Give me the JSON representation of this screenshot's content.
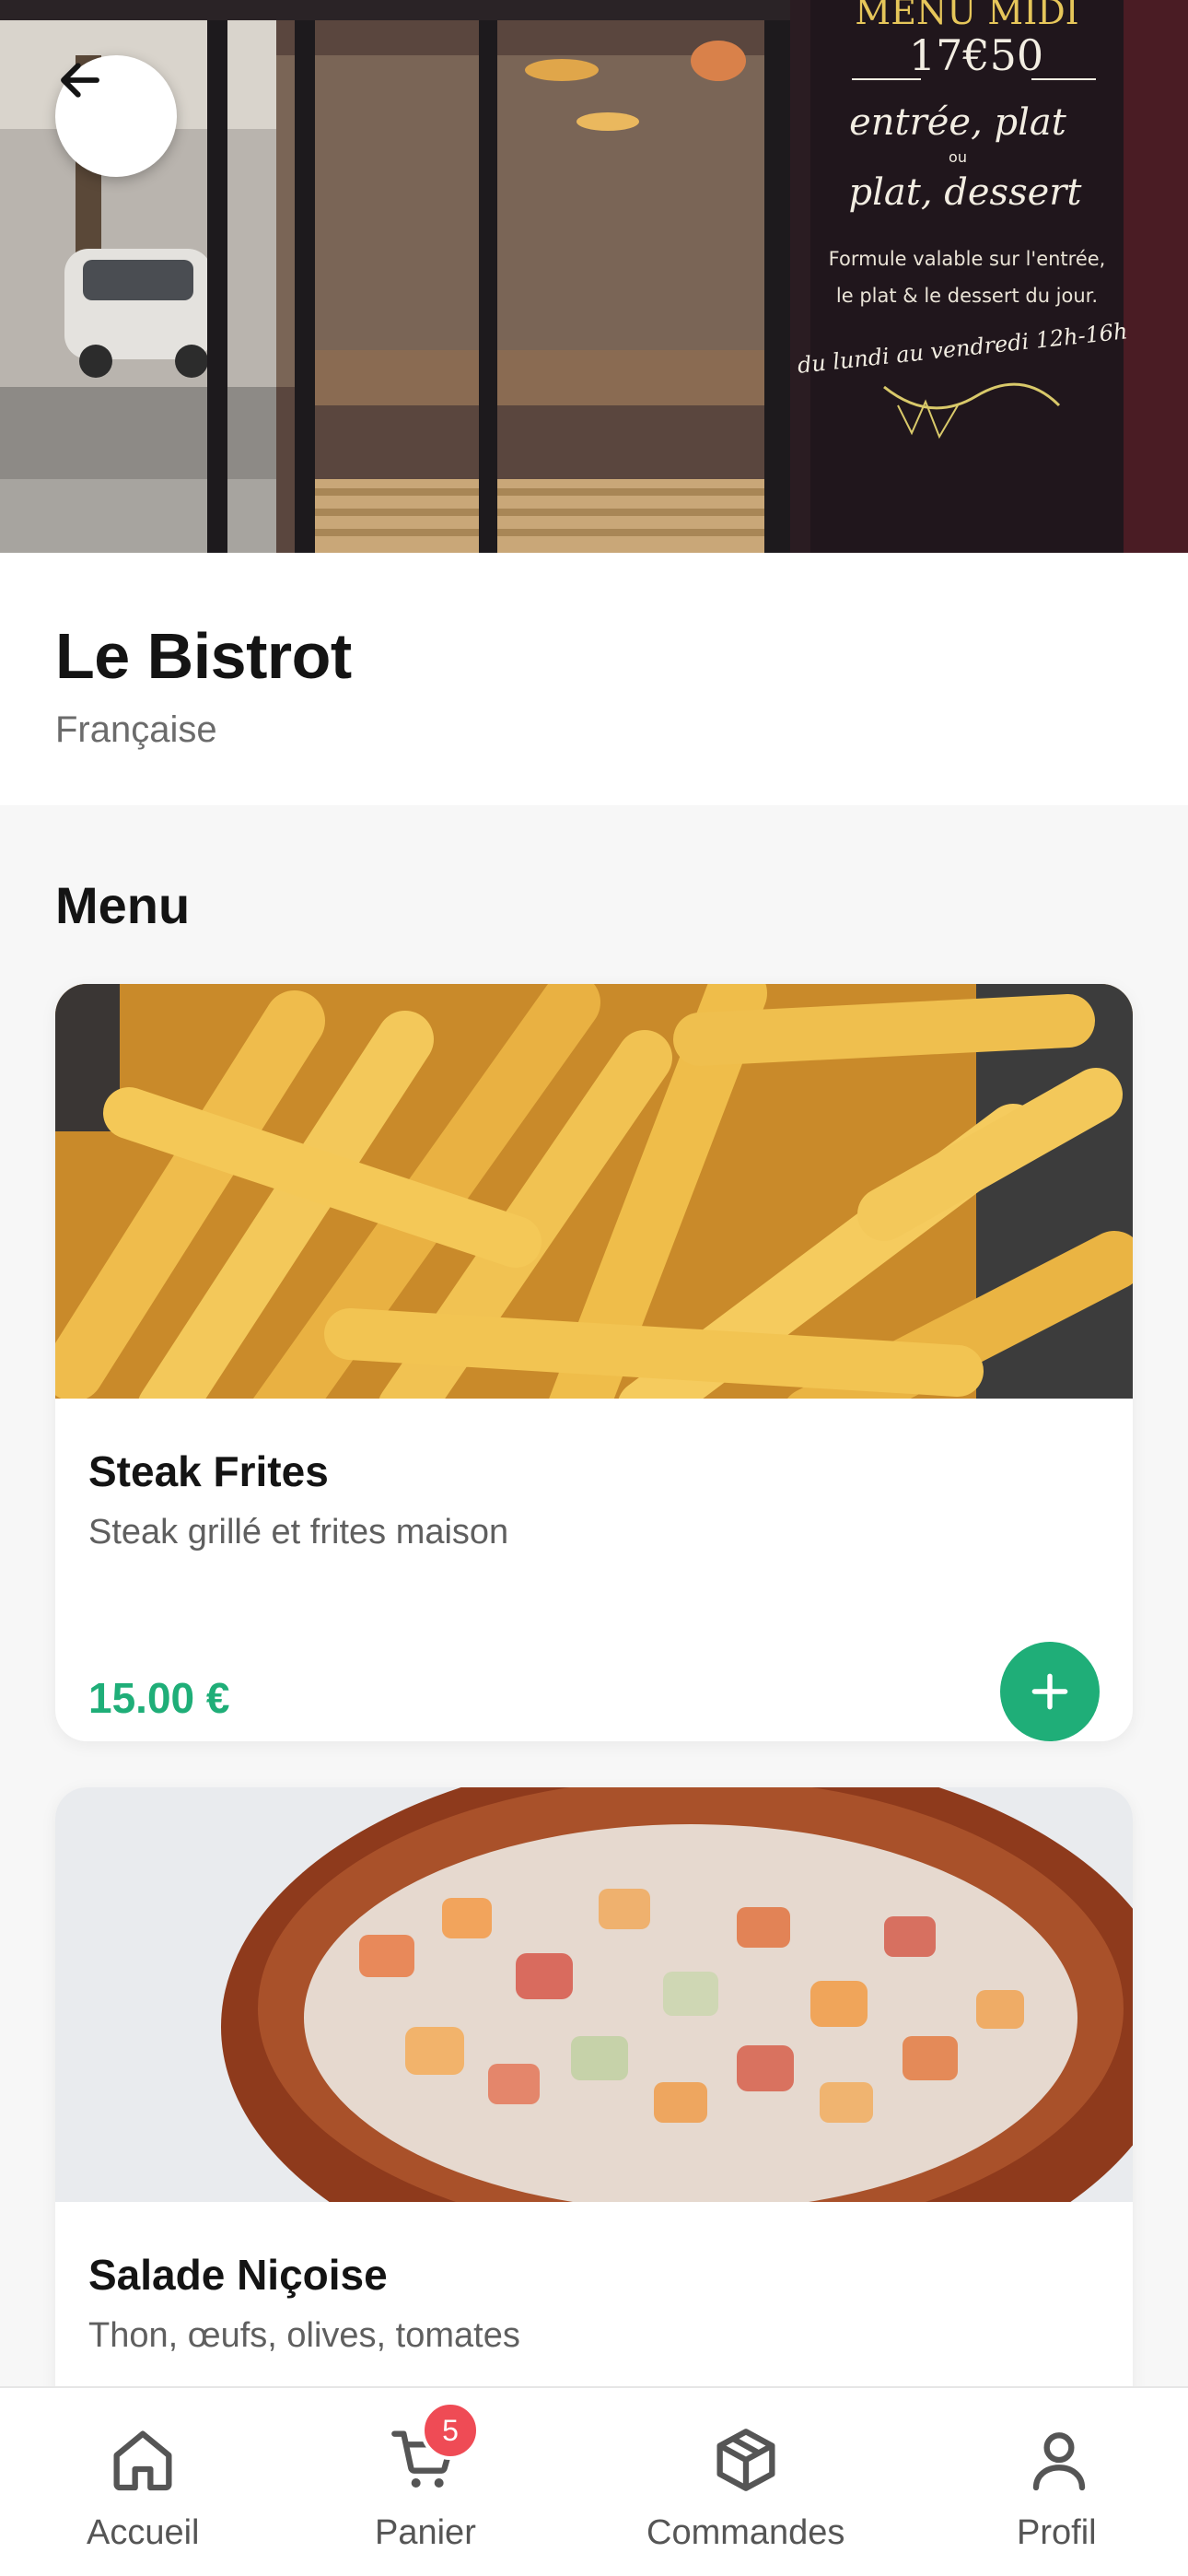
{
  "hero": {
    "chalkboard_lines": [
      "MENU MIDI",
      "17€50",
      "entrée, plat",
      "ou",
      "plat, dessert",
      "Formule valable sur l'entrée,",
      "le plat & le dessert du jour.",
      "du lundi au vendredi 12h-16h"
    ]
  },
  "restaurant": {
    "name": "Le Bistrot",
    "cuisine": "Française"
  },
  "menu": {
    "title": "Menu",
    "items": [
      {
        "name": "Steak Frites",
        "description": "Steak grillé et frites maison",
        "price": "15.00 €"
      },
      {
        "name": "Salade Niçoise",
        "description": "Thon, œufs, olives, tomates",
        "price": ""
      }
    ]
  },
  "nav": {
    "items": [
      {
        "label": "Accueil",
        "icon": "home-icon"
      },
      {
        "label": "Panier",
        "icon": "cart-icon",
        "badge": "5"
      },
      {
        "label": "Commandes",
        "icon": "package-icon"
      },
      {
        "label": "Profil",
        "icon": "user-icon"
      }
    ]
  },
  "colors": {
    "accent": "#1fae78",
    "badge": "#ef4b55"
  }
}
